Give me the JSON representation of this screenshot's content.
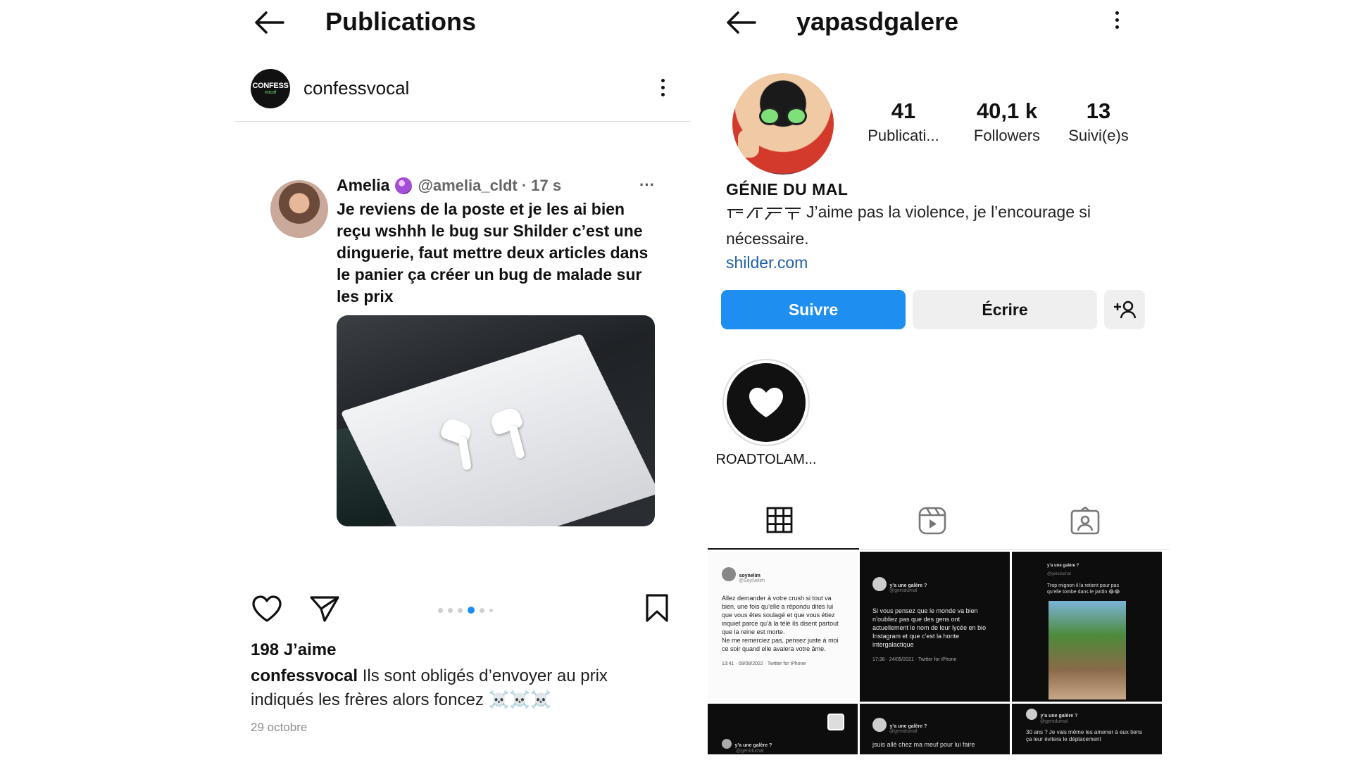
{
  "left": {
    "header": {
      "title": "Publications"
    },
    "account": {
      "avatar_text_1": "CONFESS",
      "avatar_text_2": "vocal",
      "username": "confessvocal"
    },
    "tweet": {
      "name": "Amelia",
      "handle_time": "@amelia_cldt · 17 s",
      "more": "···",
      "text": "Je reviens de la poste et je les ai bien reçu wshhh le bug sur Shilder c’est une dinguerie, faut mettre deux articles dans le panier ça créer un bug de malade sur les prix"
    },
    "carousel": {
      "count": 6,
      "active": 4
    },
    "likes": "198 J’aime",
    "caption": {
      "user": "confessvocal",
      "text": " Ils sont obligés d’envoyer au prix indiqués les frères alors foncez ☠️☠️☠️"
    },
    "date": "29 octobre"
  },
  "right": {
    "header": {
      "title": "yapasdgalere"
    },
    "stats": [
      {
        "value": "41",
        "label": "Publicati..."
      },
      {
        "value": "40,1 k",
        "label": "Followers"
      },
      {
        "value": "13",
        "label": "Suivi(e)s"
      }
    ],
    "bio": {
      "name": "GÉNIE DU MAL",
      "line1": "J’aime pas la violence, je l’encourage si",
      "line2": "nécessaire.",
      "link": "shilder.com"
    },
    "buttons": {
      "follow": "Suivre",
      "message": "Écrire",
      "add_person": "+👤"
    },
    "highlight": {
      "label": "ROADTOLAM..."
    },
    "tabs": [
      "grid-icon",
      "reels-icon",
      "tagged-icon"
    ],
    "grid": [
      {
        "name": "soynelim",
        "handle": "@SoyNelim",
        "text": "Allez demander à votre crush si tout va bien, une fois qu’elle a répondu dites lui que vous êtes soulagé et que vous étiez inquiet parce qu’à la télé ils disent partout que la reine est morte.",
        "text2": "Ne me remerciez pas, pensez juste à moi ce soir quand elle avalera votre âme.",
        "footer": "13:41 · 09/09/2022 · Twitter for iPhone"
      },
      {
        "name": "y’a une galère ?",
        "handle": "@genidumal",
        "text": "Si vous pensez que le monde va bien n’oubliez pas que des gens ont actuellement le nom de leur lycée en bio Instagram et que c’est la honte intergalactique",
        "footer": "17:38 · 24/05/2021 · Twitter for iPhone"
      },
      {
        "name": "y’a une galère ?",
        "handle": "@genidumal",
        "text": "Trop mignon il la retient pour pas qu’elle tombe dans le jardin 😂😂"
      },
      {
        "name": "y’a une galère ?",
        "handle": "@genidumal"
      },
      {
        "name": "y’a une galère ?",
        "handle": "@genidumal",
        "text": "jsuis allé chez ma meuf pour lui faire"
      },
      {
        "name": "y’a une galère ?",
        "handle": "@genidumal",
        "text": "30 ans ? Je vais même les amener à eux tiens ça leur évitera le déplacement"
      }
    ]
  }
}
